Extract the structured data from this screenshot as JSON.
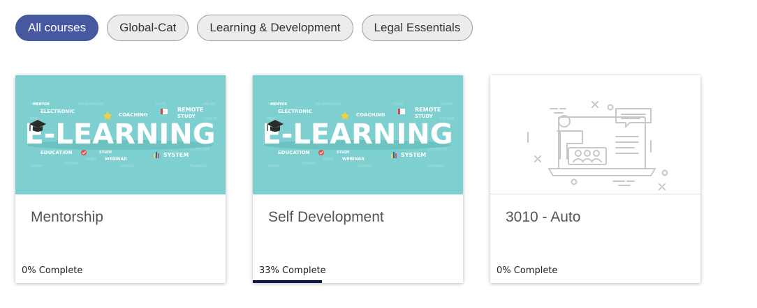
{
  "filters": [
    {
      "label": "All courses",
      "active": true
    },
    {
      "label": "Global-Cat",
      "active": false
    },
    {
      "label": "Learning & Development",
      "active": false
    },
    {
      "label": "Legal Essentials",
      "active": false
    }
  ],
  "elearning_image": {
    "headline": "E-LEARNING",
    "words": [
      "ELECTRONIC",
      "COACHING",
      "REMOTE",
      "STUDY",
      "EDUCATION",
      "WEBINAR",
      "SYSTEM",
      "MENTOR",
      "STUDY"
    ]
  },
  "courses": [
    {
      "title": "Mentorship",
      "status": "0% Complete",
      "progress": 0,
      "image": "elearning-banner"
    },
    {
      "title": "Self Development",
      "status": "33% Complete",
      "progress": 0.33,
      "image": "elearning-banner"
    },
    {
      "title": "3010 - Auto",
      "status": "0% Complete",
      "progress": 0,
      "image": "course-placeholder-illustration"
    }
  ],
  "colors": {
    "active_filter": "#4659a0",
    "banner_bg": "#7dd0cf",
    "progress": "#0d1a4a"
  }
}
